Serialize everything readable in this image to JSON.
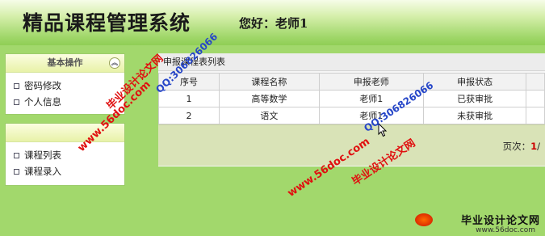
{
  "header": {
    "app_title": "精品课程管理系统",
    "greeting": "您好：老师1"
  },
  "sidebar": {
    "panel1": {
      "title": "基本操作",
      "items": [
        {
          "label": "密码修改"
        },
        {
          "label": "个人信息"
        }
      ]
    },
    "panel2": {
      "title": "",
      "items": [
        {
          "label": "课程列表"
        },
        {
          "label": "课程录入"
        }
      ]
    }
  },
  "main": {
    "title": "申报课程表列表",
    "table": {
      "headers": [
        "序号",
        "课程名称",
        "申报老师",
        "申报状态"
      ],
      "rows": [
        [
          "1",
          "高等数学",
          "老师1",
          "已获审批"
        ],
        [
          "2",
          "语文",
          "老师1",
          "未获审批"
        ]
      ]
    },
    "pager": {
      "label": "页次：",
      "current": "1",
      "separator": "/"
    }
  },
  "watermark": {
    "url1": "www.56doc.com",
    "brand1": "毕业设计论文网",
    "qq1": "QQ:306826066",
    "url2": "www.56doc.com",
    "brand2": "毕业设计论文网",
    "qq2": "QQ:306826066",
    "logo_text": "毕业设计论文网",
    "logo_url": "www.56doc.com"
  }
}
